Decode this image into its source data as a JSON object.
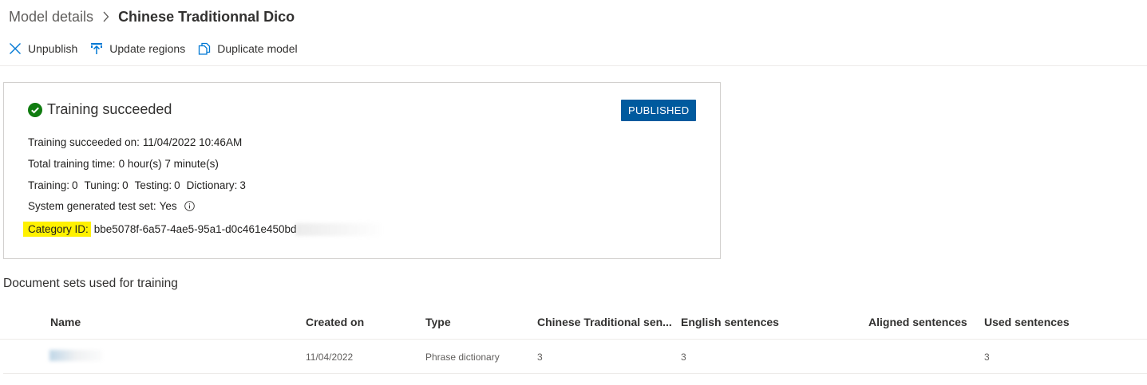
{
  "breadcrumb": {
    "parent": "Model details",
    "current": "Chinese Traditionnal Dico"
  },
  "toolbar": {
    "unpublish": "Unpublish",
    "update_regions": "Update regions",
    "duplicate_model": "Duplicate model"
  },
  "status": {
    "title": "Training succeeded",
    "badge": "PUBLISHED",
    "succeeded_on_label": "Training succeeded on:",
    "succeeded_on_value": "11/04/2022 10:46AM",
    "total_time_label": "Total training time:",
    "total_time_value": "0 hour(s) 7 minute(s)",
    "training_label": "Training:",
    "training_value": "0",
    "tuning_label": "Tuning:",
    "tuning_value": "0",
    "testing_label": "Testing:",
    "testing_value": "0",
    "dictionary_label": "Dictionary:",
    "dictionary_value": "3",
    "system_test_label": "System generated test set:",
    "system_test_value": "Yes",
    "category_label": "Category ID:",
    "category_value": "bbe5078f-6a57-4ae5-95a1-d0c461e450bd"
  },
  "colors": {
    "badge_bg": "#005a9e",
    "success_green": "#107c10",
    "highlight": "#fff100",
    "accent": "#0078d4"
  },
  "documents": {
    "title": "Document sets used for training",
    "columns": {
      "name": "Name",
      "created_on": "Created on",
      "type": "Type",
      "chinese": "Chinese Traditional sen...",
      "english": "English sentences",
      "aligned": "Aligned sentences",
      "used": "Used sentences"
    },
    "rows": [
      {
        "name": "",
        "created_on": "11/04/2022",
        "type": "Phrase dictionary",
        "chinese": "3",
        "english": "3",
        "aligned": "",
        "used": "3"
      }
    ]
  }
}
